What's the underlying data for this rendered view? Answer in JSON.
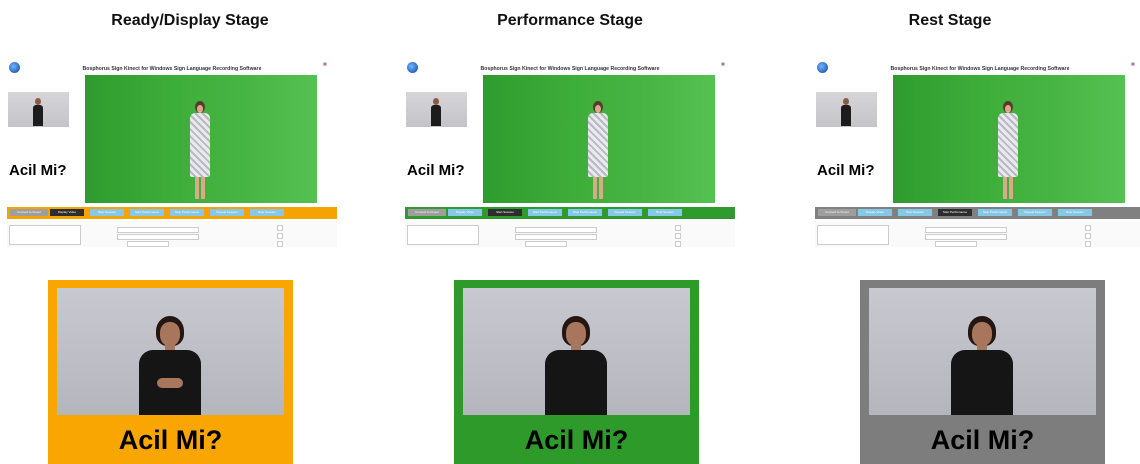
{
  "stages": [
    {
      "title": "Ready/Display Stage",
      "app_title": "Bosphorus Sign Kinect for Windows Sign Language Recording Software",
      "caption": "Acil Mi?",
      "accent": "#f5a300",
      "buttons": [
        "Connect to Kinect",
        "Display Video",
        "Start Session",
        "Start Performance",
        "Stop Performance",
        "Repeat Session",
        "Rest Session"
      ],
      "active_button": 1,
      "frame_caption": "Acil Mi?",
      "frame_color": "#f9a602",
      "hands_visible": true
    },
    {
      "title": "Performance Stage",
      "app_title": "Bosphorus Sign Kinect for Windows Sign Language Recording Software",
      "caption": "Acil Mi?",
      "accent": "#2f9b2f",
      "buttons": [
        "Connect to Kinect",
        "Display Video",
        "Start Session",
        "Start Performance",
        "Stop Performance",
        "Repeat Session",
        "Rest Session"
      ],
      "active_button": 2,
      "frame_caption": "Acil Mi?",
      "frame_color": "#2e9a2a",
      "hands_visible": false
    },
    {
      "title": "Rest Stage",
      "app_title": "Bosphorus Sign Kinect for Windows Sign Language Recording Software",
      "caption": "Acil Mi?",
      "accent": "#808080",
      "buttons": [
        "Connect to Kinect",
        "Display Video",
        "Start Session",
        "Start Performance",
        "Stop Performance",
        "Repeat Session",
        "Rest Session"
      ],
      "active_button": 3,
      "frame_caption": "Acil Mi?",
      "frame_color": "#7d7d7d",
      "hands_visible": false
    }
  ]
}
